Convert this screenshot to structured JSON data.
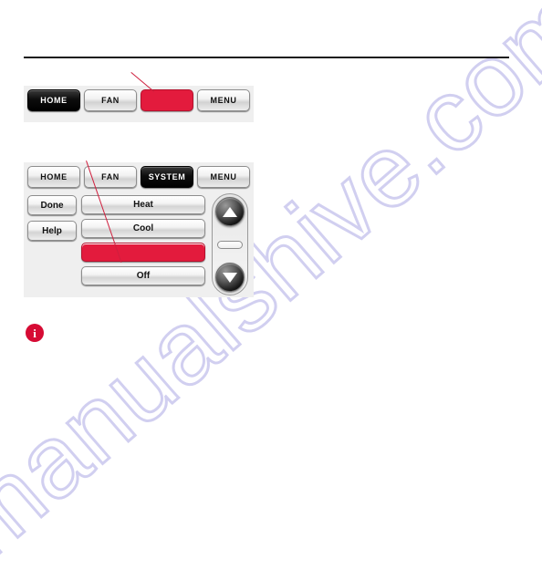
{
  "page": {
    "background_color": "#ffffff",
    "rule_color": "#1a1a1a",
    "watermark_text": "manualshive.com",
    "watermark_color": "#c9c7ee"
  },
  "colors": {
    "redaction_red": "#e31b3d",
    "callout_red": "#cf1f3e",
    "info_red": "#d60b34",
    "panel_background": "#efefef",
    "selected_tab_background": "#000000"
  },
  "panel_one": {
    "name": "thermostat-screen-home",
    "tabs": [
      {
        "label": "HOME",
        "state": "selected"
      },
      {
        "label": "FAN",
        "state": "normal"
      },
      {
        "label": "",
        "state": "redacted"
      },
      {
        "label": "MENU",
        "state": "normal"
      }
    ]
  },
  "panel_two": {
    "name": "thermostat-screen-system",
    "tabs": [
      {
        "label": "HOME",
        "state": "normal"
      },
      {
        "label": "FAN",
        "state": "normal"
      },
      {
        "label": "SYSTEM",
        "state": "selected"
      },
      {
        "label": "MENU",
        "state": "normal"
      }
    ],
    "side_buttons": [
      {
        "label": "Done"
      },
      {
        "label": "Help"
      }
    ],
    "mode_list": [
      {
        "label": "Heat",
        "state": "normal"
      },
      {
        "label": "Cool",
        "state": "normal"
      },
      {
        "label": "",
        "state": "redacted"
      },
      {
        "label": "Off",
        "state": "normal"
      }
    ],
    "stepper": {
      "up_icon": "triangle-up-icon",
      "down_icon": "triangle-down-icon",
      "readout_value": ""
    }
  },
  "note": {
    "icon": "info-icon",
    "icon_glyph": "i",
    "text": ""
  }
}
